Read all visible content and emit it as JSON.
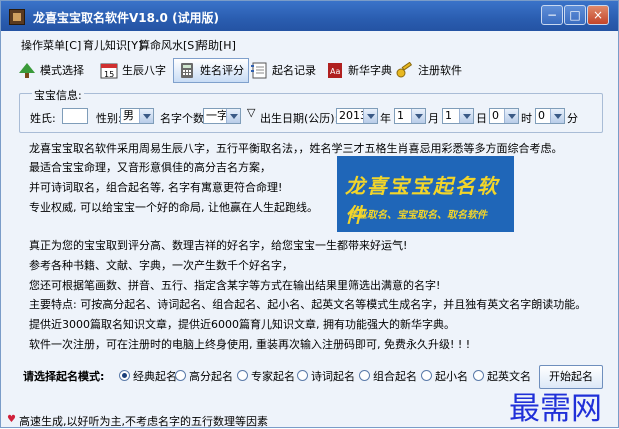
{
  "window": {
    "title": "龙喜宝宝取名软件V18.0 (试用版)",
    "min_glyph": "−",
    "max_glyph": "□",
    "close_glyph": "×"
  },
  "menu": [
    "操作菜单[C]",
    "育儿知识[Y]",
    "算命风水[S]",
    "帮助[H]"
  ],
  "toolbar": [
    {
      "label": "模式选择",
      "icon": "tree-icon",
      "active": false
    },
    {
      "label": "生辰八字",
      "icon": "calendar-icon",
      "active": false
    },
    {
      "label": "姓名评分",
      "icon": "calculator-icon",
      "active": true
    },
    {
      "label": "起名记录",
      "icon": "notebook-icon",
      "active": false
    },
    {
      "label": "新华字典",
      "icon": "dictionary-icon",
      "active": false
    },
    {
      "label": "注册软件",
      "icon": "key-icon",
      "active": false
    }
  ],
  "info": {
    "legend": "宝宝信息:",
    "surname_label": "姓氏:",
    "surname_value": "",
    "gender_label": "性别:",
    "gender_value": "男",
    "namecount_label": "名字个数:",
    "namecount_value": "一字",
    "triangle": "▽",
    "birth_label": "出生日期(公历):",
    "year_value": "2013",
    "year_unit": "年",
    "month_value": "1",
    "month_unit": "月",
    "day_value": "1",
    "day_unit": "日",
    "hour_value": "0",
    "hour_unit": "时",
    "minute_value": "0",
    "minute_unit": "分"
  },
  "intro_lines": [
    "龙喜宝宝取名软件采用周易生辰八字，五行平衡取名法，，姓名学三才五格生肖喜忌用彩悉等多方面综合考虑。",
    "最适合宝宝命理，又音形意俱佳的高分吉名方案，",
    "并可诗词取名，组合起名等, 名字有寓意更符合命理!",
    "专业权威, 可以给宝宝一个好的命局, 让他赢在人生起跑线。"
  ],
  "feature_lines": [
    "真正为您的宝宝取到评分高、数理吉祥的好名字，给您宝宝一生都带来好运气!",
    "参考各种书籍、文献、字典，一次产生数千个好名字，",
    "您还可根据笔画数、拼音、五行、指定含某字等方式在输出结果里筛选出满意的名字!",
    "主要特点: 可按高分起名、诗词起名、组合起名、起小名、起英文名等模式生成名字，并且独有英文名字朗读功能。",
    "提供近3000篇取名知识文章，提供近6000篇育儿知识文章, 拥有功能强大的新华字典。",
    "软件一次注册，可在注册时的电脑上终身使用, 重装再次输入注册码即可, 免费永久升级! ! !"
  ],
  "banner": {
    "logo": "龙喜宝宝起名软件",
    "sub": "专业取名、宝宝取名、取名软件"
  },
  "mode": {
    "label": "请选择起名模式:",
    "options": [
      "经典起名",
      "高分起名",
      "专家起名",
      "诗词起名",
      "组合起名",
      "起小名",
      "起英文名"
    ],
    "selected": "经典起名",
    "start_label": "开始起名"
  },
  "status": "高速生成,以好听为主,不考虑名字的五行数理等因素",
  "watermark": "最需网",
  "colors": {
    "title_bar": "#2a5db0",
    "banner_bg": "#1f66b8",
    "banner_text": "#f2d52a",
    "watermark": "#2030d8"
  }
}
